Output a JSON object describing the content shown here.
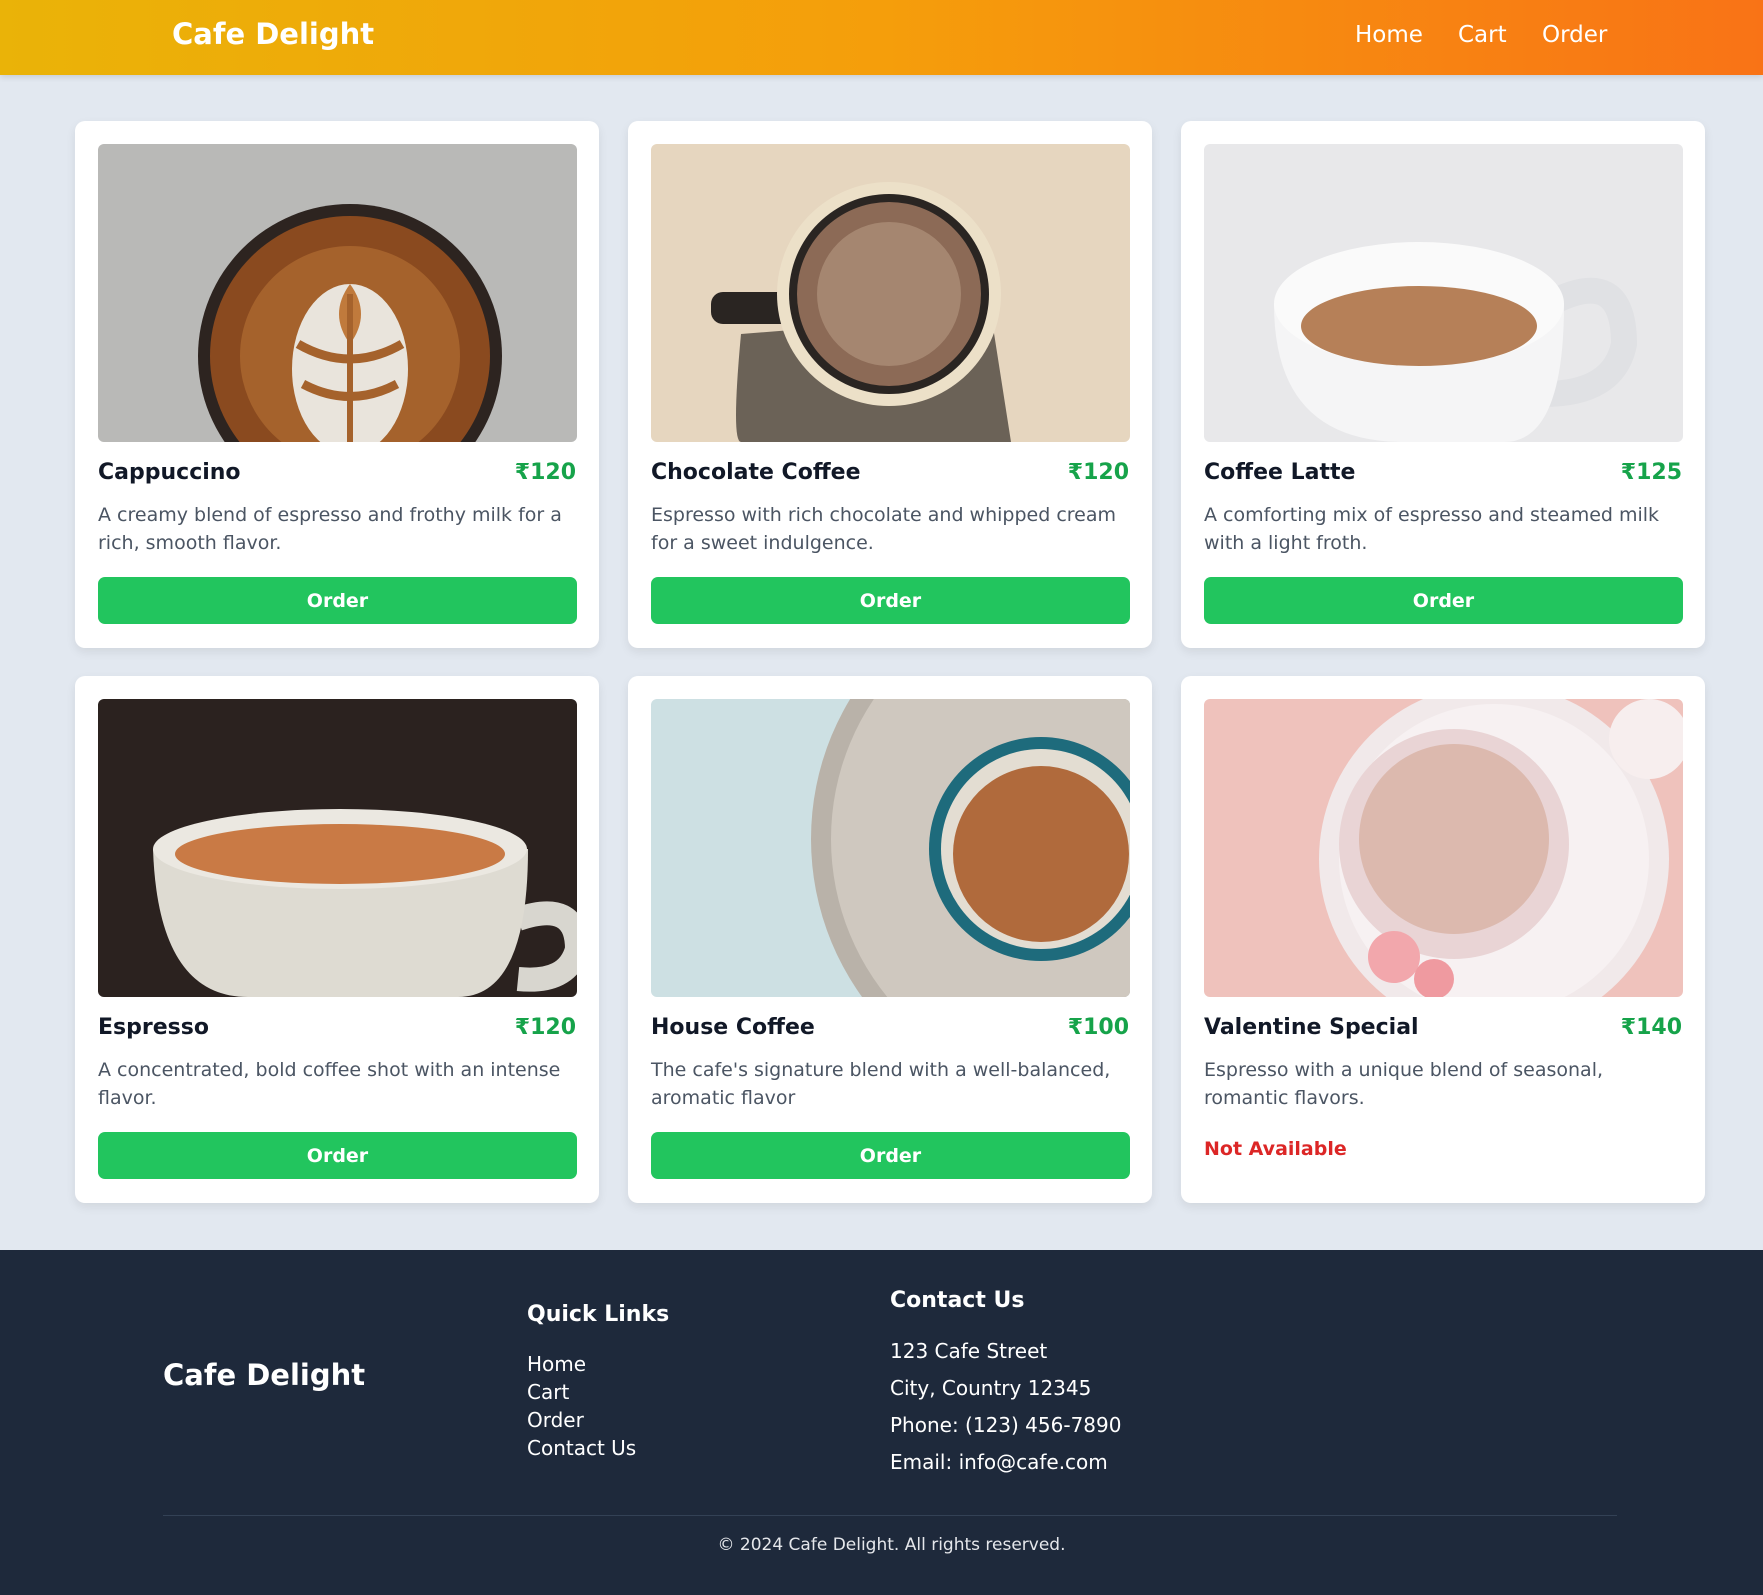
{
  "header": {
    "brand": "Cafe Delight",
    "nav": [
      "Home",
      "Cart",
      "Order"
    ]
  },
  "products": [
    {
      "name": "Cappuccino",
      "price": "₹120",
      "description": "A creamy blend of espresso and frothy milk for a rich, smooth flavor.",
      "action": "Order",
      "image": "cappuccino-photo"
    },
    {
      "name": "Chocolate Coffee",
      "price": "₹120",
      "description": "Espresso with rich chocolate and whipped cream for a sweet indulgence.",
      "action": "Order",
      "image": "chocolate-coffee-photo"
    },
    {
      "name": "Coffee Latte",
      "price": "₹125",
      "description": "A comforting mix of espresso and steamed milk with a light froth.",
      "action": "Order",
      "image": "coffee-latte-photo"
    },
    {
      "name": "Espresso",
      "price": "₹120",
      "description": "A concentrated, bold coffee shot with an intense flavor.",
      "action": "Order",
      "image": "espresso-photo"
    },
    {
      "name": "House Coffee",
      "price": "₹100",
      "description": "The cafe's signature blend with a well-balanced, aromatic flavor",
      "action": "Order",
      "image": "house-coffee-photo"
    },
    {
      "name": "Valentine Special",
      "price": "₹140",
      "description": "Espresso with a unique blend of seasonal, romantic flavors.",
      "status": "Not Available",
      "image": "valentine-special-photo"
    }
  ],
  "footer": {
    "brand": "Cafe Delight",
    "quick_links_title": "Quick Links",
    "quick_links": [
      "Home",
      "Cart",
      "Order",
      "Contact Us"
    ],
    "contact_title": "Contact Us",
    "contact": [
      "123 Cafe Street",
      "City, Country 12345",
      "Phone: (123) 456-7890",
      "Email: info@cafe.com"
    ],
    "copyright": "© 2024 Cafe Delight. All rights reserved."
  },
  "colors": {
    "header_start": "#eab308",
    "header_end": "#f97316",
    "accent_green": "#22c55e",
    "price_green": "#16a34a",
    "unavailable_red": "#dc2626",
    "footer_bg": "#1e293b"
  }
}
